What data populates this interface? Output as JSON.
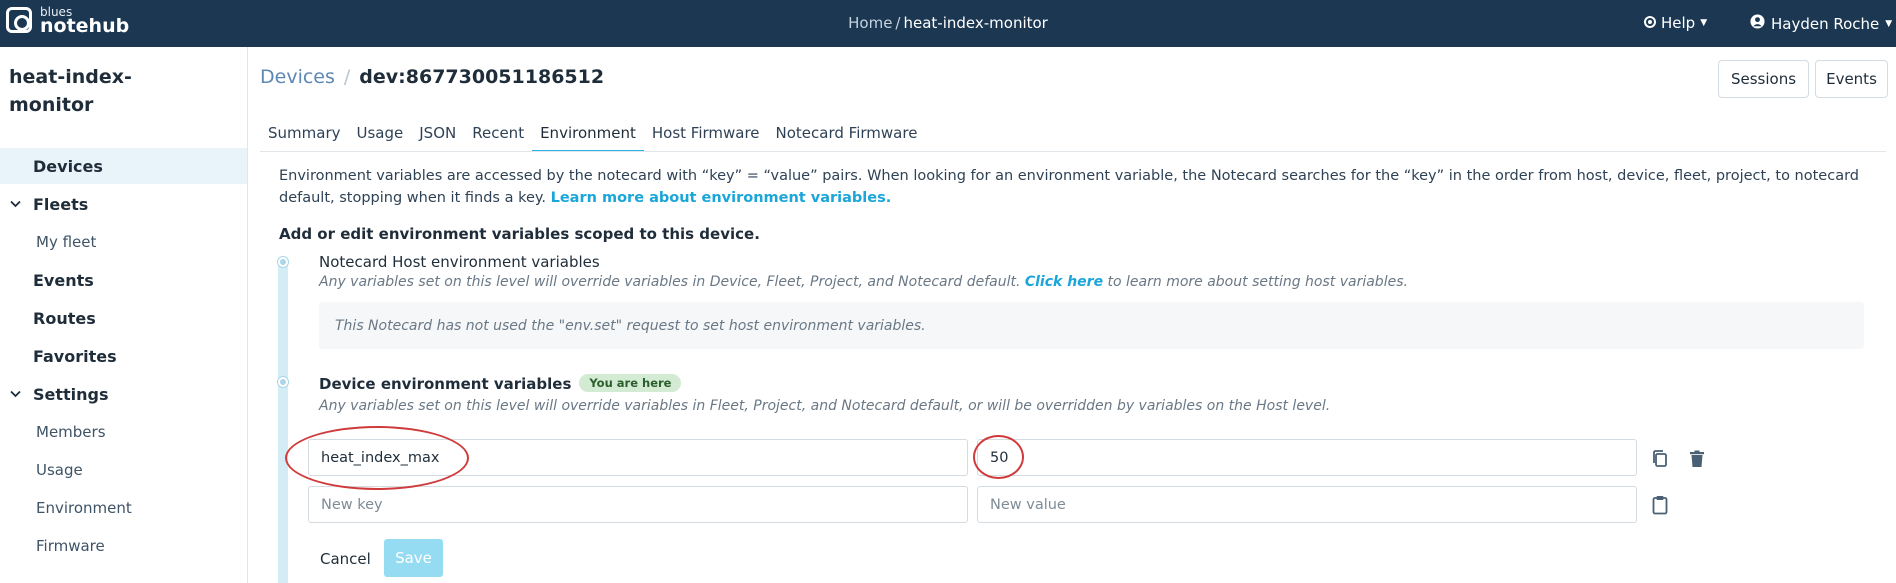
{
  "brand": {
    "small": "blues",
    "big": "notehub"
  },
  "breadcrumb": {
    "home": "Home",
    "separator": "/",
    "current": "heat-index-monitor"
  },
  "header": {
    "help_label": "Help",
    "user_name": "Hayden Roche"
  },
  "sidebar": {
    "project_title": "heat-index-monitor",
    "items": [
      {
        "label": "Devices"
      },
      {
        "label": "Fleets"
      },
      {
        "label": "My fleet"
      },
      {
        "label": "Events"
      },
      {
        "label": "Routes"
      },
      {
        "label": "Favorites"
      },
      {
        "label": "Settings"
      },
      {
        "label": "Members"
      },
      {
        "label": "Usage"
      },
      {
        "label": "Environment"
      },
      {
        "label": "Firmware"
      }
    ]
  },
  "page": {
    "devices_link": "Devices",
    "separator": "/",
    "device_id": "dev:867730051186512",
    "sessions_label": "Sessions",
    "events_label": "Events"
  },
  "tabs": [
    {
      "label": "Summary"
    },
    {
      "label": "Usage"
    },
    {
      "label": "JSON"
    },
    {
      "label": "Recent"
    },
    {
      "label": "Environment"
    },
    {
      "label": "Host Firmware"
    },
    {
      "label": "Notecard Firmware"
    }
  ],
  "intro": {
    "text": "Environment variables are accessed by the notecard with “key” = “value” pairs. When looking for an environment variable, the Notecard searches for the “key” in the order from host, device, fleet, project, to notecard default, stopping when it finds a key.",
    "link": "Learn more about environment variables."
  },
  "scope_title": "Add or edit environment variables scoped to this device.",
  "host_section": {
    "title": "Notecard Host environment variables",
    "desc_before": "Any variables set on this level will override variables in Device, Fleet, Project, and Notecard default.",
    "desc_link": "Click here",
    "desc_after": "to learn more about setting host variables.",
    "empty_note": "This Notecard has not used the \"env.set\" request to set host environment variables."
  },
  "device_section": {
    "title": "Device environment variables",
    "badge": "You are here",
    "desc": "Any variables set on this level will override variables in Fleet, Project, and Notecard default, or will be overridden by variables on the Host level."
  },
  "variables": [
    {
      "key": "heat_index_max",
      "value": "50"
    }
  ],
  "new_variable": {
    "key_placeholder": "New key",
    "value_placeholder": "New value"
  },
  "actions": {
    "cancel_label": "Cancel",
    "save_label": "Save"
  },
  "colors": {
    "navbar": "#1b3752",
    "accent": "#2bb3e5",
    "link": "#1aa6d9",
    "save_disabled": "#95dcf3",
    "annotation": "#cf3b3b"
  }
}
